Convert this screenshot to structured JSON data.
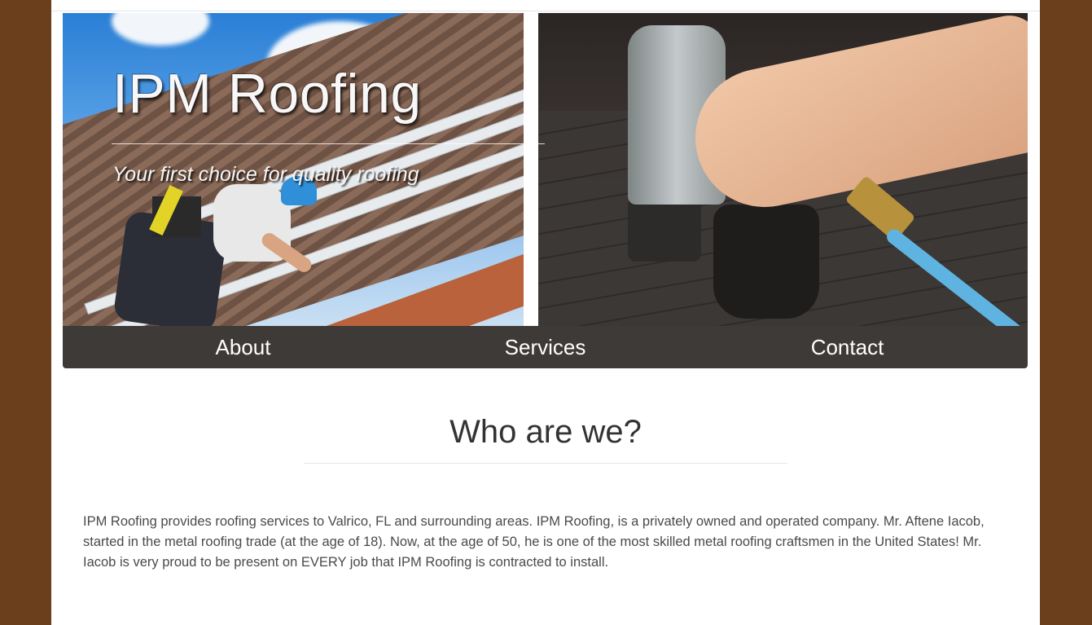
{
  "hero": {
    "title": "IPM Roofing",
    "tagline": "Your first choice for quality roofing"
  },
  "nav": {
    "items": [
      {
        "label": "About"
      },
      {
        "label": "Services"
      },
      {
        "label": "Contact"
      }
    ]
  },
  "about": {
    "heading": "Who are we?",
    "body": "IPM Roofing provides roofing services to Valrico, FL and surrounding areas. IPM Roofing, is a privately owned and operated company. Mr. Aftene Iacob, started in the metal roofing trade (at the age of 18). Now, at the age of 50, he is one of the most skilled metal roofing craftsmen in the United States! Mr. Iacob is very proud to be present on EVERY job that IPM Roofing is contracted to install."
  },
  "colors": {
    "page_background": "#6b3f1c",
    "content_background": "#ffffff",
    "nav_background": "#3e3a37",
    "nav_text": "#ffffff",
    "heading_text": "#333333",
    "body_text": "#4a4a4a"
  }
}
